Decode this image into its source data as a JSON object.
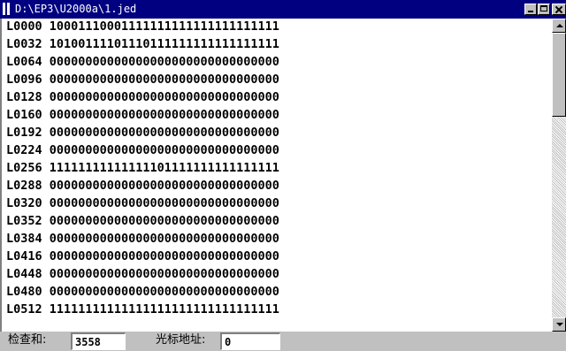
{
  "window": {
    "title": "D:\\EP3\\U2000a\\1.jed"
  },
  "editor": {
    "lines": [
      "L0000 10001110001111111111111111111111",
      "L0032 10100111101110111111111111111111",
      "L0064 00000000000000000000000000000000",
      "L0096 00000000000000000000000000000000",
      "L0128 00000000000000000000000000000000",
      "L0160 00000000000000000000000000000000",
      "L0192 00000000000000000000000000000000",
      "L0224 00000000000000000000000000000000",
      "L0256 11111111111111101111111111111111",
      "L0288 00000000000000000000000000000000",
      "L0320 00000000000000000000000000000000",
      "L0352 00000000000000000000000000000000",
      "L0384 00000000000000000000000000000000",
      "L0416 00000000000000000000000000000000",
      "L0448 00000000000000000000000000000000",
      "L0480 00000000000000000000000000000000",
      "L0512 11111111111111111111111111111111"
    ]
  },
  "statusbar": {
    "checksum_label": "检查和:",
    "checksum_value": "3558",
    "cursor_label": "光标地址:",
    "cursor_value": "0"
  }
}
